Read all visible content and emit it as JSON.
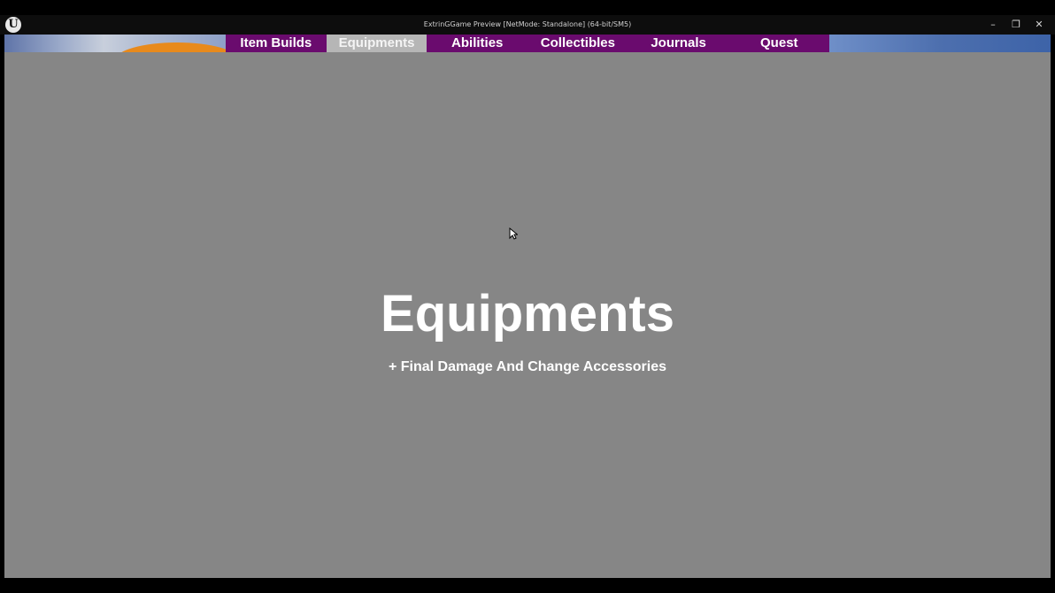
{
  "window": {
    "title": "ExtrinGGame Preview [NetMode: Standalone]  (64-bit/SM5)",
    "logo_icon": "unreal-engine-logo",
    "logo_glyph": "U",
    "controls": {
      "minimize": "–",
      "maximize": "❐",
      "close": "✕"
    }
  },
  "nav": {
    "tabs": [
      {
        "label": "Item Builds",
        "active": false
      },
      {
        "label": "Equipments",
        "active": true
      },
      {
        "label": "Abilities",
        "active": false
      },
      {
        "label": "Collectibles",
        "active": false
      },
      {
        "label": "Journals",
        "active": false
      },
      {
        "label": "Quest",
        "active": false
      }
    ],
    "colors": {
      "tab_bg": "#6a0b6e",
      "active_tab_bg": "#b6b6b6",
      "text": "#ffffff"
    }
  },
  "content": {
    "heading": "Equipments",
    "subheading": "+ Final Damage And Change Accessories",
    "background_color": "#868686"
  }
}
